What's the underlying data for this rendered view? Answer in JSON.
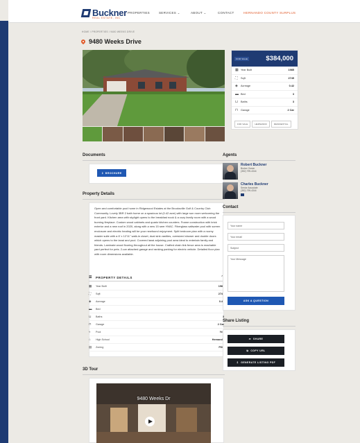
{
  "header": {
    "brand": "Buckner",
    "brand_sub": "REAL ESTATE, INC.",
    "nav": [
      "PROPERTIES",
      "SERVICES ⌄",
      "ABOUT ⌄",
      "CONTACT",
      "HERNANDO COUNTY SURPLUS"
    ]
  },
  "breadcrumb": "HOME / PROPERTIES / 9480 WEEKS DRIVE",
  "listing": {
    "title": "9480 Weeks Drive",
    "badge": "FOR SALE",
    "price": "$384,000",
    "stats": [
      {
        "icon": "calendar-icon",
        "glyph": "▦",
        "label": "Year Built",
        "value": "1985"
      },
      {
        "icon": "sqft-icon",
        "glyph": "⛶",
        "label": "Sqft",
        "value": "2745"
      },
      {
        "icon": "acreage-icon",
        "glyph": "◈",
        "label": "Acreage",
        "value": "0.42"
      },
      {
        "icon": "bed-icon",
        "glyph": "▬",
        "label": "Bed",
        "value": "3"
      },
      {
        "icon": "bath-icon",
        "glyph": "⊔",
        "label": "Baths",
        "value": "3"
      },
      {
        "icon": "garage-icon",
        "glyph": "⊓",
        "label": "Garage",
        "value": "2 Car"
      }
    ],
    "tags": [
      "FOR SALE",
      "HERNANDO",
      "RESIDENTIAL"
    ]
  },
  "documents": {
    "heading": "Documents",
    "button": "BROCHURE"
  },
  "details": {
    "heading": "Property Details",
    "description": "Open and comfortable pool home in Ridgewood Estates at the Brooksville Golf & Country Club Community. Lovely 3BR 2 bath home on a spacious lot (0.42 acre) with large sun room welcoming the front yard. Kitchen area with skylight opens to the breakfast nook & a cozy family room with a wood burning fireplace. Custom wood cabinets and quartz kitchen counters. Frame construction with brick exterior and a new roof in 2020, along with a new 15 seer HVAC. Fiberglass saltwater pool with screen enclosure and electric heating will be your newfound enjoyment. Split bedroom plan with a roomy master suite with a 6' x 12'11\" walk-in closet, dual sink vanities, oversized shower and double doors which opens to the lanai and pool. Covered lanai adjoining pool area ideal to entertain family and friends. Laminate wood flooring throughout all the house. Crafted chain link fence area is reachable yard perfect for pets. 2-car attached garage and ranking parking for electric vehicle. Detailed floor plan with room dimensions available.",
    "table_heading": "PROPERTY DETAILS",
    "rows": [
      {
        "icon": "calendar-icon",
        "glyph": "▦",
        "label": "Year Built",
        "value": "1985"
      },
      {
        "icon": "sqft-icon",
        "glyph": "⛶",
        "label": "Sqft",
        "value": "2745"
      },
      {
        "icon": "acreage-icon",
        "glyph": "◈",
        "label": "Acreage",
        "value": "0.42"
      },
      {
        "icon": "bed-icon",
        "glyph": "▬",
        "label": "Bed",
        "value": "3"
      },
      {
        "icon": "bath-icon",
        "glyph": "⊔",
        "label": "Baths",
        "value": "3"
      },
      {
        "icon": "garage-icon",
        "glyph": "⊓",
        "label": "Garage",
        "value": "2 Car"
      },
      {
        "icon": "pool-icon",
        "glyph": "≈",
        "label": "Pool",
        "value": "Yes"
      },
      {
        "icon": "school-icon",
        "glyph": "⌂",
        "label": "High School",
        "value": "Hernando"
      },
      {
        "icon": "zoning-icon",
        "glyph": "▤",
        "label": "Zoning",
        "value": "PDP"
      }
    ]
  },
  "agents": {
    "heading": "Agents",
    "list": [
      {
        "name": "Robert Buckner",
        "role": "Broker Owner",
        "phone": "(352) 799-4344"
      },
      {
        "name": "Charles Buckner",
        "role": "Senior Associate",
        "phone": "(352) 799-4344"
      }
    ]
  },
  "contact": {
    "heading": "Contact",
    "name_ph": "Your name",
    "email_ph": "Your email",
    "subject_ph": "Subject",
    "message_ph": "Your Message",
    "button": "ASK A QUESTION"
  },
  "share": {
    "heading": "Share Listing",
    "buttons": [
      "SHARE",
      "COPY URL",
      "GENERATE LISTING PDF"
    ]
  },
  "tour": {
    "heading": "3D Tour",
    "overlay_title": "9480 Weeks Dr"
  },
  "colors": {
    "brand": "#1f3b73",
    "accent": "#e05a2a",
    "button": "#1f58b3",
    "dark_button": "#1b1f25"
  }
}
